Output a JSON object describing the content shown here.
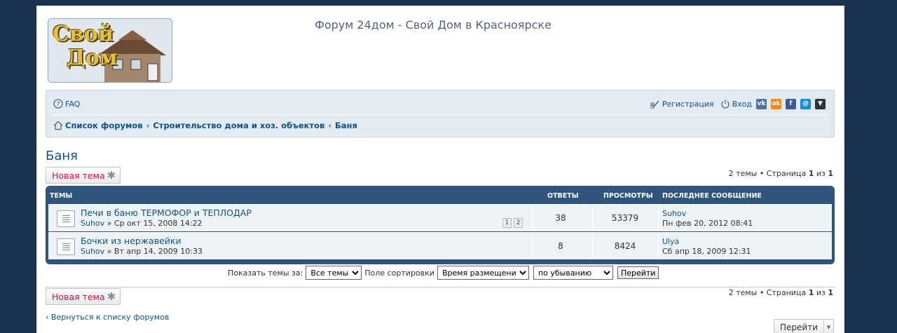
{
  "header": {
    "site_title": "Форум 24дом - Свой Дом в Красноярске",
    "logo_text_line1": "Свой",
    "logo_text_line2": "Дом"
  },
  "navbar": {
    "faq": "FAQ",
    "register": "Регистрация",
    "login": "Вход",
    "social": [
      "vk-icon",
      "odnoklassniki-icon",
      "facebook-icon",
      "mailru-icon",
      "more-dropdown-icon"
    ],
    "breadcrumbs": [
      "Список форумов",
      "Строительство дома и хоз. объектов",
      "Баня"
    ]
  },
  "page": {
    "title": "Баня",
    "new_topic": "Новая тема",
    "pagination_prefix": "2 темы • Страница",
    "pagination_current": "1",
    "pagination_of": "из",
    "pagination_total": "1"
  },
  "topics": {
    "headers": {
      "topics": "ТЕМЫ",
      "replies": "ОТВЕТЫ",
      "views": "ПРОСМОТРЫ",
      "last_post": "ПОСЛЕДНЕЕ СООБЩЕНИЕ"
    },
    "rows": [
      {
        "title": "Печи в баню ТЕРМОФОР и ТЕПЛОДАР",
        "author": "Suhov",
        "date": "» Ср окт 15, 2008 14:22",
        "pages": [
          "1",
          "2"
        ],
        "replies": "38",
        "views": "53379",
        "last_author": "Suhov",
        "last_date": "Пн фев 20, 2012 08:41"
      },
      {
        "title": "Бочки из нержавейки",
        "author": "Suhov",
        "date": "» Вт апр 14, 2009 10:33",
        "pages": [],
        "replies": "8",
        "views": "8424",
        "last_author": "Ulya",
        "last_date": "Сб апр 18, 2009 12:31"
      }
    ]
  },
  "sort": {
    "show_label": "Показать темы за:",
    "show_value": "Все темы",
    "sort_label": "Поле сортировки",
    "sort_value": "Время размещения",
    "order_value": "по убыванию",
    "go": "Перейти"
  },
  "footer": {
    "back": "Вернуться к списку форумов",
    "jump": "Перейти"
  },
  "colors": {
    "background": "#1b3150",
    "link": "#105289",
    "table_header": "#30557c",
    "new_topic": "#d31141"
  }
}
